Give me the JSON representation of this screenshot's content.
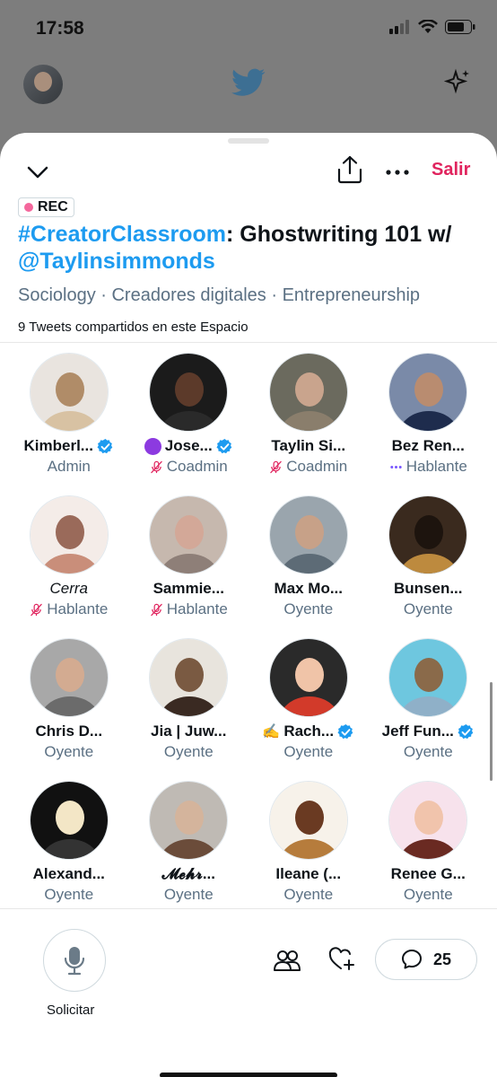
{
  "status": {
    "time": "17:58"
  },
  "space": {
    "rec_label": "REC",
    "title_hashtag": "#CreatorClassroom",
    "title_text": ": Ghostwriting 101 w/",
    "title_mention": "@Taylinsimmonds",
    "topics": "Sociology · Creadores digitales · Entrepreneurship",
    "tweets_shared": "9 Tweets compartidos en este Espacio",
    "leave_label": "Salir"
  },
  "participants": [
    {
      "name": "Kimberl...",
      "role": "Admin",
      "verified": true,
      "role_icon": ""
    },
    {
      "name": "Jose...",
      "role": "Coadmin",
      "verified": true,
      "role_icon": "mic-off-icon",
      "prefix": "purple-circle"
    },
    {
      "name": "Taylin Si...",
      "role": "Coadmin",
      "verified": false,
      "role_icon": "mic-off-icon"
    },
    {
      "name": "Bez Ren...",
      "role": "Hablante",
      "verified": false,
      "role_icon": "speaking-dots-icon"
    },
    {
      "name": "Cerra",
      "role": "Hablante",
      "verified": false,
      "role_icon": "mic-off-pink-icon",
      "italic": true
    },
    {
      "name": "Sammie...",
      "role": "Hablante",
      "verified": false,
      "role_icon": "mic-off-pink-icon"
    },
    {
      "name": "Max Mo...",
      "role": "Oyente",
      "verified": false,
      "role_icon": ""
    },
    {
      "name": "Bunsen...",
      "role": "Oyente",
      "verified": false,
      "role_icon": ""
    },
    {
      "name": "Chris D...",
      "role": "Oyente",
      "verified": false,
      "role_icon": ""
    },
    {
      "name": "Jia | Juw...",
      "role": "Oyente",
      "verified": false,
      "role_icon": ""
    },
    {
      "name": "Rach...",
      "role": "Oyente",
      "verified": true,
      "role_icon": "",
      "prefix": "✍️"
    },
    {
      "name": "Jeff Fun...",
      "role": "Oyente",
      "verified": true,
      "role_icon": ""
    },
    {
      "name": "Alexand...",
      "role": "Oyente",
      "verified": false,
      "role_icon": ""
    },
    {
      "name": "𝓜𝓮𝓱𝓻...",
      "role": "Oyente",
      "verified": false,
      "role_icon": ""
    },
    {
      "name": "Ileane (...",
      "role": "Oyente",
      "verified": false,
      "role_icon": ""
    },
    {
      "name": "Renee G...",
      "role": "Oyente",
      "verified": false,
      "role_icon": ""
    }
  ],
  "bottom": {
    "request_label": "Solicitar",
    "comment_count": "25"
  },
  "colors": {
    "accent": "#1d9bf0",
    "leave": "#e0245e",
    "rec_dot": "#f4679c",
    "muted_pink": "#e0245e",
    "speaking": "#7856ff"
  }
}
